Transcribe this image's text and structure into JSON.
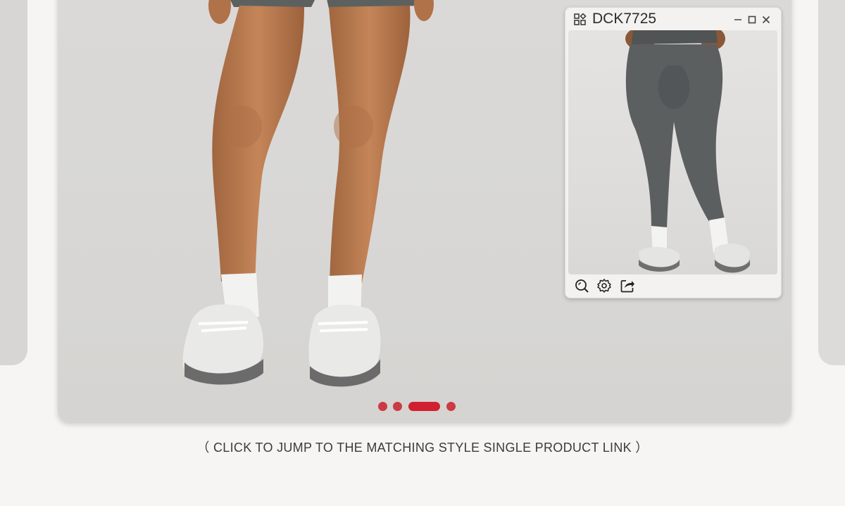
{
  "popup": {
    "title": "DCK7725"
  },
  "caption": {
    "text": "（ CLICK TO JUMP TO THE MATCHING STYLE SINGLE PRODUCT LINK ）"
  },
  "carousel": {
    "slide_count": 4,
    "active_index": 2
  },
  "icons": {
    "popup_app": "grid-icon",
    "minimize": "minimize-icon",
    "maximize": "maximize-icon",
    "close": "close-icon",
    "zoom": "zoom-icon",
    "settings": "gear-icon",
    "share": "share-icon"
  },
  "colors": {
    "accent": "#d1202f",
    "page_background": "#f6f5f3"
  }
}
